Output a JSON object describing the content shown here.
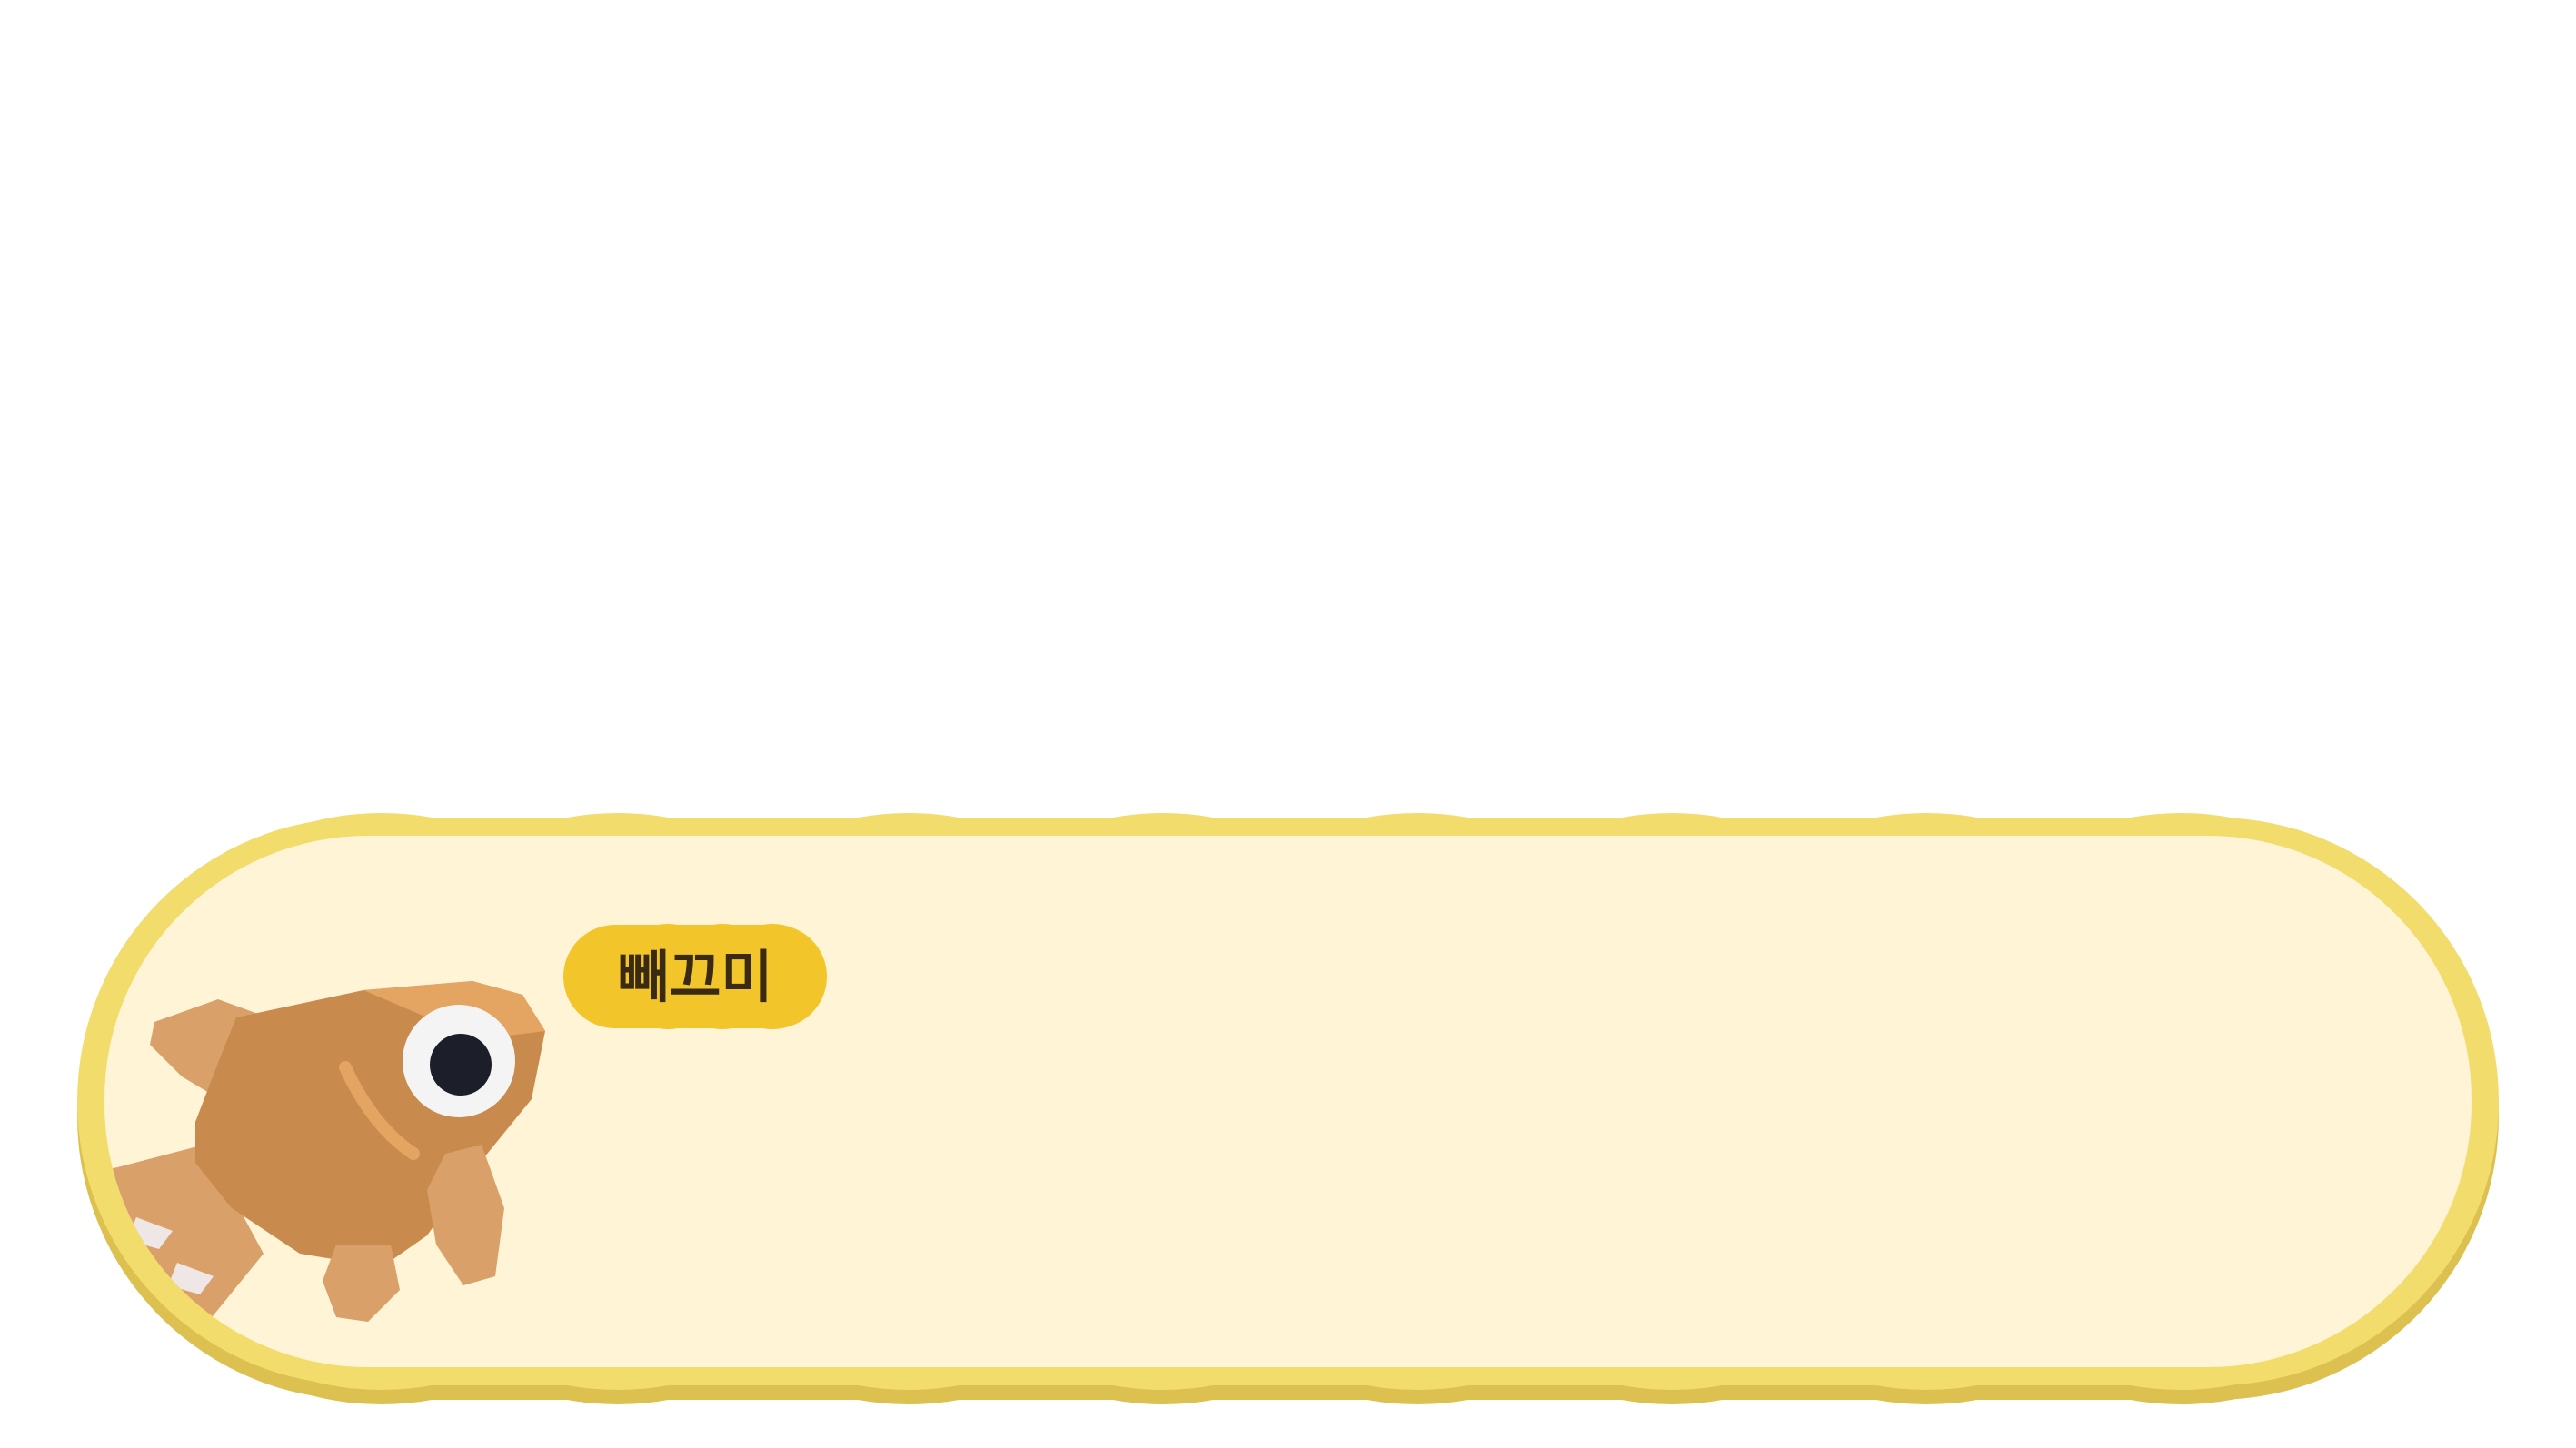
{
  "scene": {
    "background_color": "#ffffff"
  },
  "dialogue_box": {
    "speaker_name": "빼끄미",
    "message": "",
    "colors": {
      "outer_border": "#f2dc6c",
      "outer_shadow": "#dcc050",
      "inner_fill": "#fff4d6",
      "name_tag_fill": "#f2c62a",
      "name_tag_text": "#3a2a12"
    },
    "portrait": {
      "character": "goldfish",
      "icon": "goldfish-portrait",
      "colors": {
        "body": "#c98a4e",
        "body_highlight": "#e4a462",
        "fin": "#d9a06a",
        "eye_white": "#f4f4f4",
        "pupil": "#1c1e2a"
      }
    }
  }
}
